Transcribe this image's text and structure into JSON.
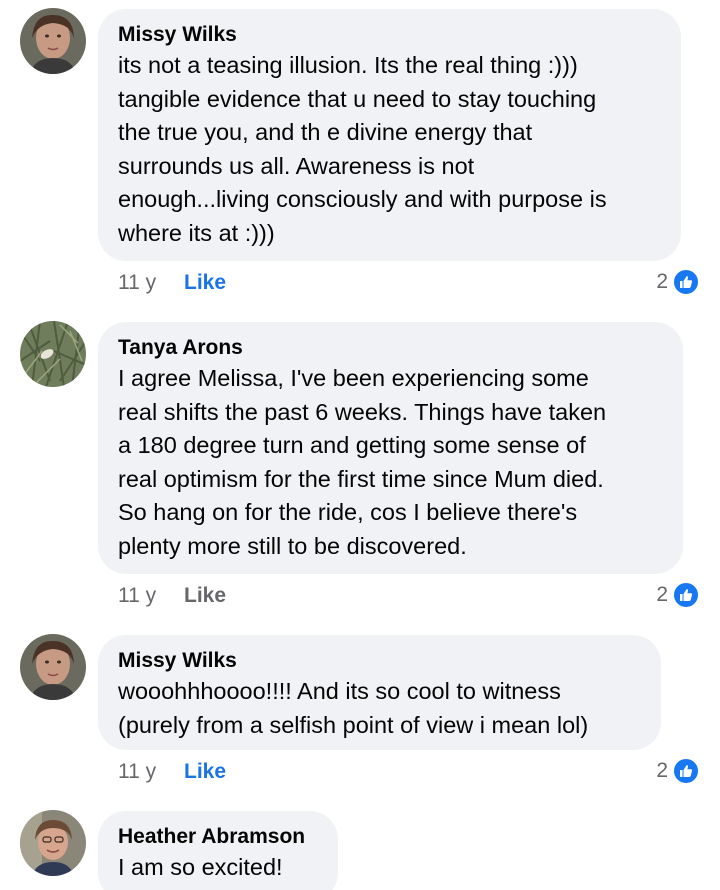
{
  "colors": {
    "bubble_bg": "#f0f2f5",
    "like_blue": "#1b74e4",
    "meta_gray": "#65676b",
    "badge_blue": "#1877f2"
  },
  "comments": [
    {
      "author": "Missy Wilks",
      "text": "its not a teasing illusion. Its the real thing :)))\ntangible evidence that u need to stay touching\nthe true you, and th e divine energy that\nsurrounds us all. Awareness is not\nenough...living consciously and with purpose is\nwhere its at :)))",
      "time": "11 y",
      "like_label": "Like",
      "liked": true,
      "reaction_count": "2",
      "reaction_icon": "thumbs-up-icon"
    },
    {
      "author": "Tanya Arons",
      "text": "I agree Melissa, I've been experiencing some\nreal shifts the past 6 weeks.  Things have taken\na 180 degree turn and getting some sense of\nreal optimism for the first time since Mum died.\nSo hang on for the ride, cos I believe there's\nplenty more still to be discovered.",
      "time": "11 y",
      "like_label": "Like",
      "liked": false,
      "reaction_count": "2",
      "reaction_icon": "thumbs-up-icon"
    },
    {
      "author": "Missy Wilks",
      "text": "wooohhhoooo!!!! And its so cool to witness\n(purely from a selfish point of view i mean lol)",
      "time": "11 y",
      "like_label": "Like",
      "liked": true,
      "reaction_count": "2",
      "reaction_icon": "thumbs-up-icon"
    },
    {
      "author": "Heather Abramson",
      "text": "I am so excited!"
    }
  ]
}
